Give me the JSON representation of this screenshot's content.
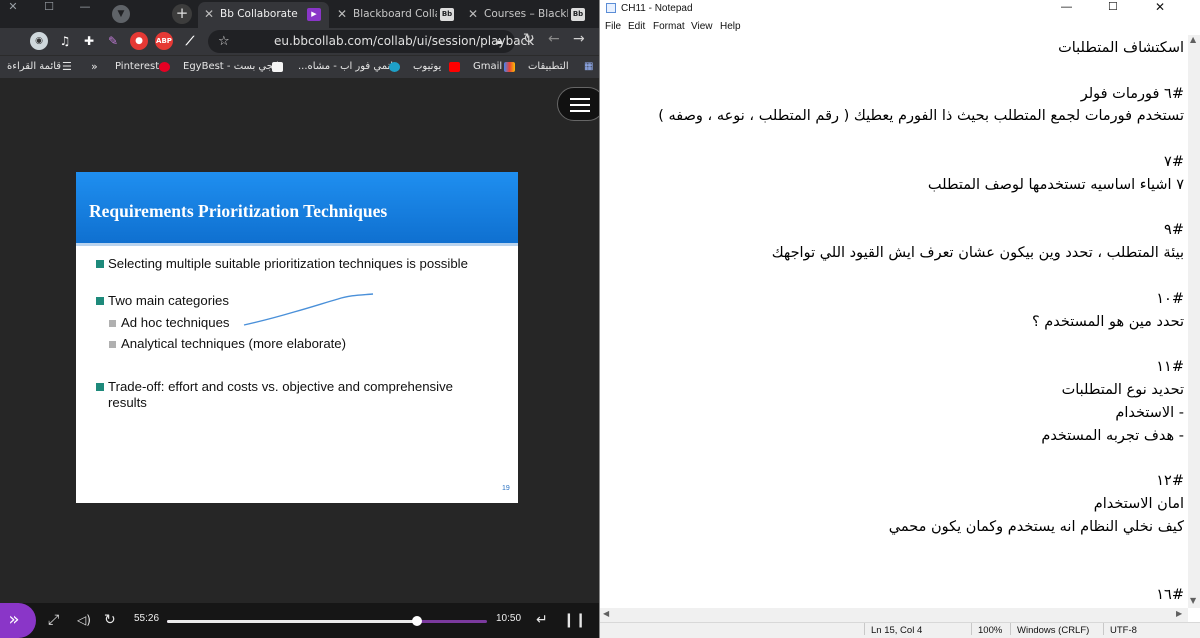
{
  "browser": {
    "tabs": [
      {
        "label": "Bb Collaborate",
        "active": true,
        "favicon": "play-icon"
      },
      {
        "label": "Blackboard Collab",
        "active": false,
        "favicon": "Bb"
      },
      {
        "label": "Courses – Blackboa",
        "active": false,
        "favicon": "Bb"
      }
    ],
    "new_tab": "+",
    "url": "eu.bbcollab.com/collab/ui/session/playback",
    "bookmarks": [
      {
        "label": "التطبيقات",
        "icon": "apps-icon"
      },
      {
        "label": "Gmail",
        "icon": "gmail-icon"
      },
      {
        "label": "يوتيوب",
        "icon": "youtube-icon"
      },
      {
        "label": "انمي فور اب - مشاه...",
        "icon": "anime-icon"
      },
      {
        "label": "ايجي بست - EgyBest",
        "icon": "egybest-icon"
      },
      {
        "label": "Pinterest",
        "icon": "pinterest-icon"
      }
    ],
    "bookmarks_more": "»",
    "reading_list": "قائمة القراءة",
    "ext_abp_label": "ABP"
  },
  "slide": {
    "title": "Requirements Prioritization Techniques",
    "bullets": [
      "Selecting multiple suitable prioritization techniques is possible",
      "Two main categories"
    ],
    "sub_bullets": [
      "Ad hoc techniques",
      "Analytical techniques (more elaborate)"
    ],
    "bullet_3": "Trade-off: effort and costs vs. objective and comprehensive results",
    "number": "19",
    "accent": "#1580e0"
  },
  "player": {
    "elapsed": "55:26",
    "remaining": "10:50",
    "progress": 0.78,
    "accent": "#8a36c8"
  },
  "notepad": {
    "title": "CH11 - Notepad",
    "menu": [
      "File",
      "Edit",
      "Format",
      "View",
      "Help"
    ],
    "lines": [
      "اسكتشاف المتطلبات",
      "",
      "#٦ فورمات فولر",
      "تستخدم فورمات لجمع المتطلب بحيث ذا الفورم يعطيك ( رقم المتطلب ، نوعه ، وصفه )",
      "",
      "#٧",
      "٧ اشياء اساسيه تستخدمها لوصف المتطلب",
      "",
      "#٩",
      "بيئة المتطلب ، تحدد وين بيكون عشان تعرف ايش القيود اللي تواجهك",
      "",
      "#١٠",
      "تحدد مين هو المستخدم ؟",
      "",
      "#١١",
      "تحديد نوع المتطلبات",
      "- الاستخدام",
      "- هدف تجربه المستخدم",
      "",
      "#١٢",
      "امان الاستخدام",
      "كيف نخلي النظام انه يستخدم وكمان يكون محمي",
      "",
      "",
      "#١٦"
    ],
    "status": {
      "position": "Ln 15, Col 4",
      "zoom": "100%",
      "line_endings": "Windows (CRLF)",
      "encoding": "UTF-8"
    }
  }
}
